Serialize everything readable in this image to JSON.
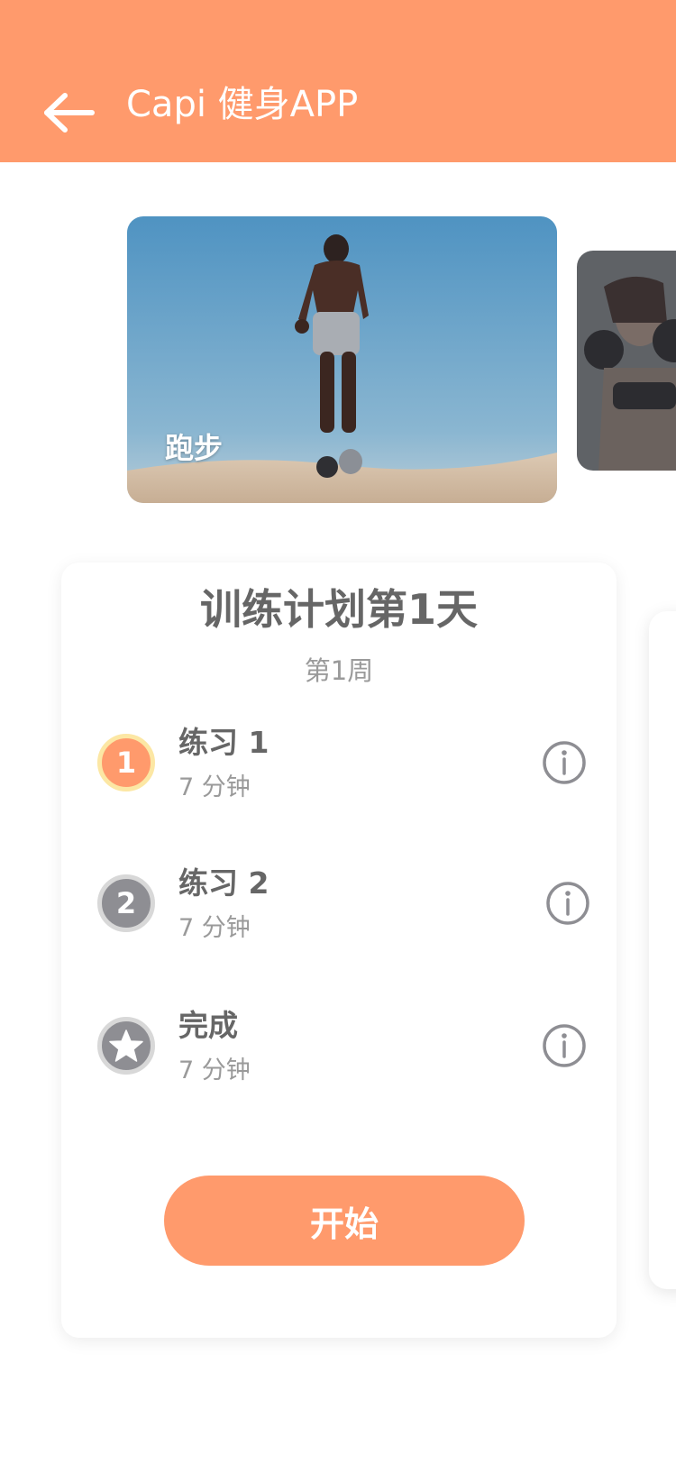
{
  "header": {
    "title": "Capi 健身APP",
    "back_icon": "arrow-left-icon",
    "background": "#FF9A6C"
  },
  "carousel": {
    "items": [
      {
        "label": "跑步"
      },
      {
        "label": ""
      }
    ]
  },
  "plan": {
    "title": "训练计划第1天",
    "week": "第1周",
    "steps": [
      {
        "badge": "1",
        "name": "练习 1",
        "duration": "7 分钟",
        "state": "active"
      },
      {
        "badge": "2",
        "name": "练习 2",
        "duration": "7 分钟",
        "state": "pending"
      },
      {
        "badge": "star-icon",
        "name": "完成",
        "duration": "7 分钟",
        "state": "pending"
      }
    ],
    "start_label": "开始"
  },
  "colors": {
    "accent": "#FF9A6C",
    "active_ring": "#FCE7A4",
    "pending": "#8e8e93",
    "text_primary": "#666666",
    "text_secondary": "#9a9a9a"
  }
}
